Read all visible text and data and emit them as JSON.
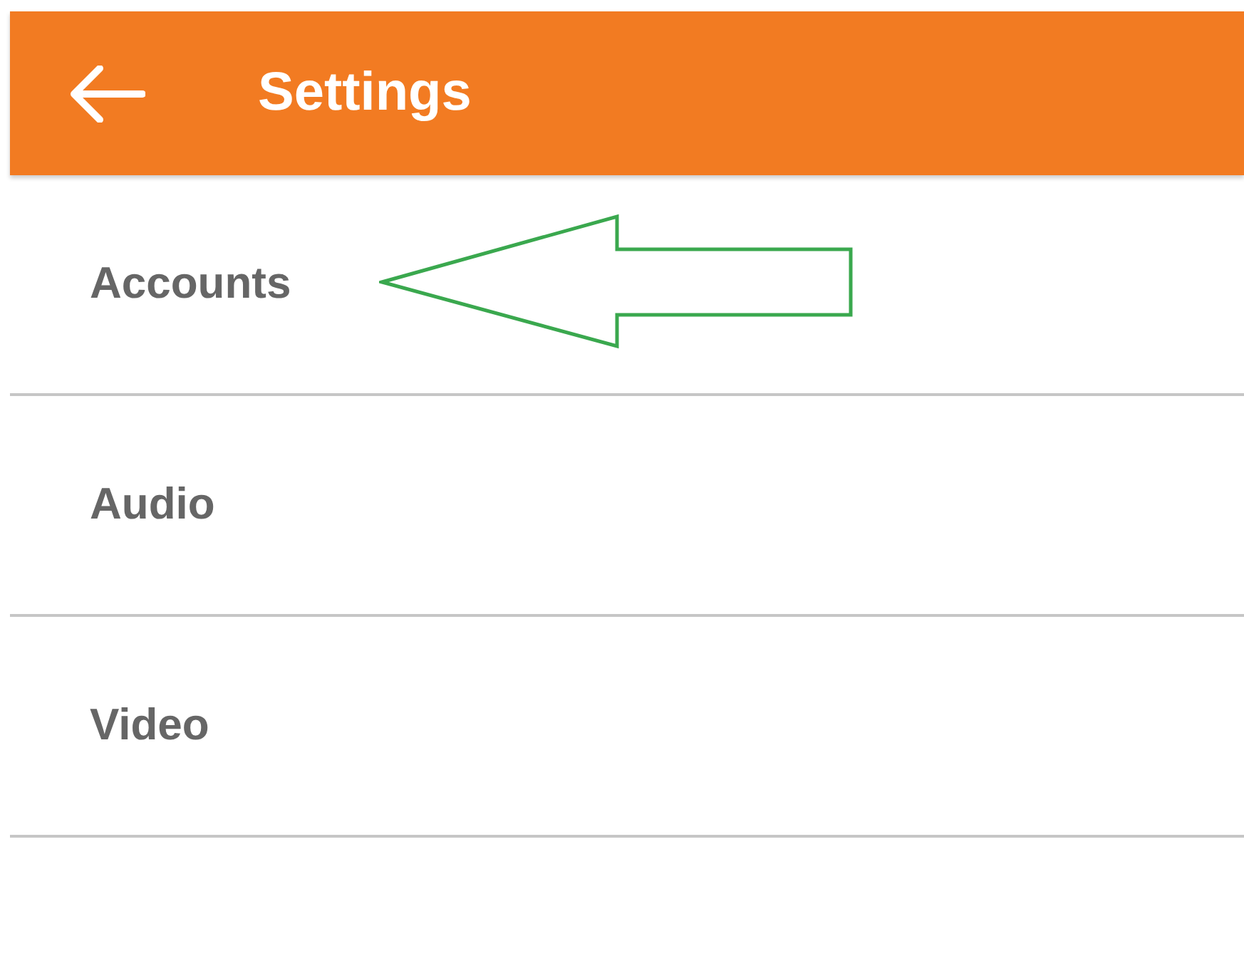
{
  "app_bar": {
    "title": "Settings"
  },
  "items": [
    {
      "label": "Accounts",
      "highlighted": true
    },
    {
      "label": "Audio",
      "highlighted": false
    },
    {
      "label": "Video",
      "highlighted": false
    }
  ]
}
